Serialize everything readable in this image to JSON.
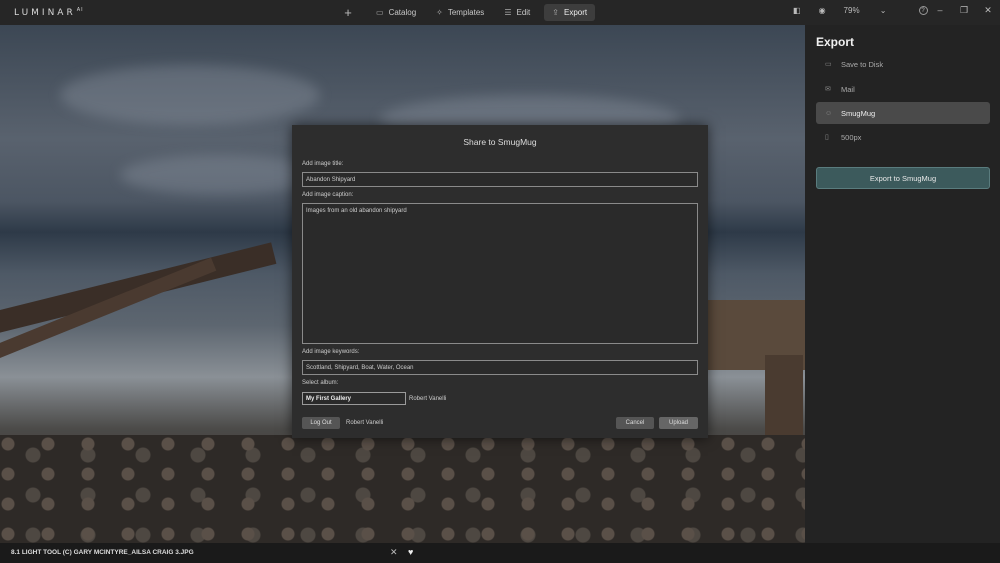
{
  "app": {
    "logo": "LUMINAR",
    "logo_sup": "AI"
  },
  "nav": {
    "plus": "+",
    "items": [
      {
        "label": "Catalog",
        "icon": "folder-icon",
        "glyph": "▭"
      },
      {
        "label": "Templates",
        "icon": "sparkle-icon",
        "glyph": "✧"
      },
      {
        "label": "Edit",
        "icon": "sliders-icon",
        "glyph": "☰"
      },
      {
        "label": "Export",
        "icon": "share-icon",
        "glyph": "⇪"
      }
    ]
  },
  "tools": {
    "zoom": "79%",
    "compare_glyph": "◧",
    "eye_glyph": "◉",
    "chevron_glyph": "⌄",
    "help_glyph": "?"
  },
  "window": {
    "minimize": "–",
    "restore": "❐",
    "close": "✕"
  },
  "panel": {
    "title": "Export",
    "items": [
      {
        "label": "Save to Disk",
        "glyph": "▭"
      },
      {
        "label": "Mail",
        "glyph": "✉"
      },
      {
        "label": "SmugMug",
        "glyph": "☺"
      },
      {
        "label": "500px",
        "glyph": "▯"
      }
    ],
    "export_button": "Export to SmugMug"
  },
  "dialog": {
    "title": "Share to SmugMug",
    "title_label": "Add image title:",
    "title_value": "Abandon Shipyard",
    "caption_label": "Add image caption:",
    "caption_value": "Images from an old abandon shipyard",
    "keywords_label": "Add image keywords:",
    "keywords_value": "Scottland, Shipyard, Boat, Water, Ocean",
    "album_label": "Select album:",
    "album_value": "My First Gallery",
    "album_user": "Robert Vanelli",
    "logout": "Log Out",
    "logout_user": "Robert Vanelli",
    "cancel": "Cancel",
    "upload": "Upload"
  },
  "bottom": {
    "filename": "8.1 LIGHT TOOL (C) GARY MCINTYRE_AILSA CRAIG 3.JPG",
    "close_glyph": "✕",
    "heart_glyph": "♥"
  }
}
